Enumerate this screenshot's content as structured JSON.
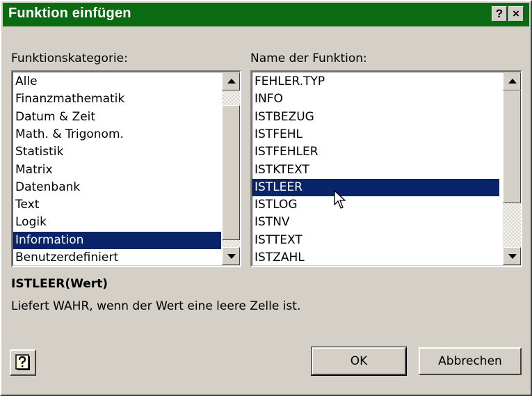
{
  "dialog": {
    "title": "Funktion einfügen",
    "help_glyph": "?",
    "close_glyph": "×"
  },
  "category": {
    "label": "Funktionskategorie:",
    "items": [
      "Alle",
      "Finanzmathematik",
      "Datum & Zeit",
      "Math. & Trigonom.",
      "Statistik",
      "Matrix",
      "Datenbank",
      "Text",
      "Logik",
      "Information",
      "Benutzerdefiniert"
    ],
    "selected": "Information"
  },
  "functions": {
    "label": "Name der Funktion:",
    "items": [
      "FEHLER.TYP",
      "INFO",
      "ISTBEZUG",
      "ISTFEHL",
      "ISTFEHLER",
      "ISTKTEXT",
      "ISTLEER",
      "ISTLOG",
      "ISTNV",
      "ISTTEXT",
      "ISTZAHL"
    ],
    "selected": "ISTLEER"
  },
  "description": {
    "signature": "ISTLEER(Wert)",
    "text": "Liefert WAHR, wenn der Wert eine leere Zelle ist."
  },
  "buttons": {
    "ok": "OK",
    "cancel": "Abbrechen",
    "help_icon": "question-mark-icon"
  },
  "colors": {
    "titlebar": "#0b6b12",
    "selection": "#0a246a",
    "face": "#d4d0c8"
  }
}
